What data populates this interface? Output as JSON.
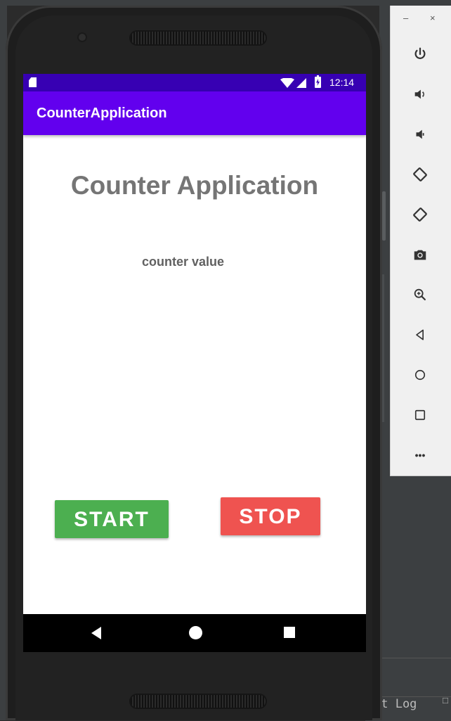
{
  "ide": {
    "bottom_tab_label": "nt Log"
  },
  "emulator_toolbar": {
    "minimize_label": "–",
    "close_label": "×",
    "buttons": [
      {
        "icon": "power-icon"
      },
      {
        "icon": "volume-up-icon"
      },
      {
        "icon": "volume-down-icon"
      },
      {
        "icon": "rotate-left-icon"
      },
      {
        "icon": "rotate-right-icon"
      },
      {
        "icon": "camera-icon"
      },
      {
        "icon": "zoom-icon"
      },
      {
        "icon": "back-icon"
      },
      {
        "icon": "home-icon"
      },
      {
        "icon": "overview-icon"
      },
      {
        "icon": "more-icon"
      }
    ],
    "more_label": "•••"
  },
  "status_bar": {
    "time": "12:14"
  },
  "app_bar": {
    "title": "CounterApplication"
  },
  "main": {
    "heading": "Counter Application",
    "counter_label": "counter value",
    "start_label": "START",
    "stop_label": "STOP"
  },
  "colors": {
    "status_bar": "#3700b3",
    "app_bar": "#6200ee",
    "start_button": "#4caf50",
    "stop_button": "#ef5350"
  }
}
